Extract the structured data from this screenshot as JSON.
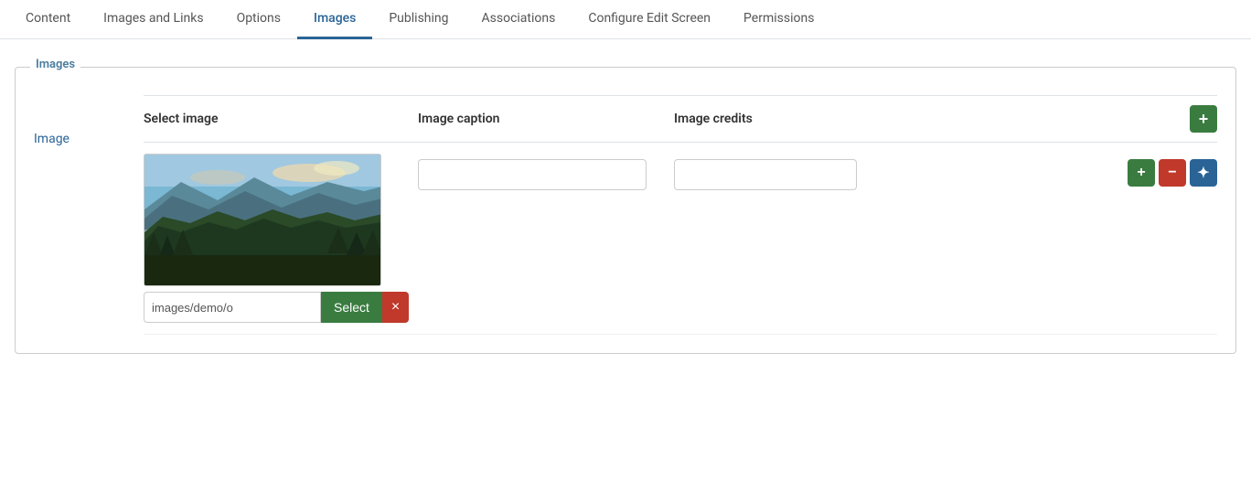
{
  "tabs": [
    {
      "id": "content",
      "label": "Content",
      "active": false
    },
    {
      "id": "images-and-links",
      "label": "Images and Links",
      "active": false
    },
    {
      "id": "options",
      "label": "Options",
      "active": false
    },
    {
      "id": "images",
      "label": "Images",
      "active": true
    },
    {
      "id": "publishing",
      "label": "Publishing",
      "active": false
    },
    {
      "id": "associations",
      "label": "Associations",
      "active": false
    },
    {
      "id": "configure-edit-screen",
      "label": "Configure Edit Screen",
      "active": false
    },
    {
      "id": "permissions",
      "label": "Permissions",
      "active": false
    }
  ],
  "section": {
    "legend": "Images",
    "image_label": "Image"
  },
  "table": {
    "col_select_image": "Select image",
    "col_caption": "Image caption",
    "col_credits": "Image credits"
  },
  "row": {
    "file_path": "images/demo/o",
    "caption_value": "",
    "credits_value": "",
    "caption_placeholder": "",
    "credits_placeholder": "",
    "select_btn": "Select",
    "remove_btn": "×"
  },
  "buttons": {
    "add": "+",
    "minus": "−",
    "move": "✦"
  },
  "icons": {
    "plus": "+",
    "minus": "−",
    "cross": "✕",
    "move": "⊕"
  }
}
